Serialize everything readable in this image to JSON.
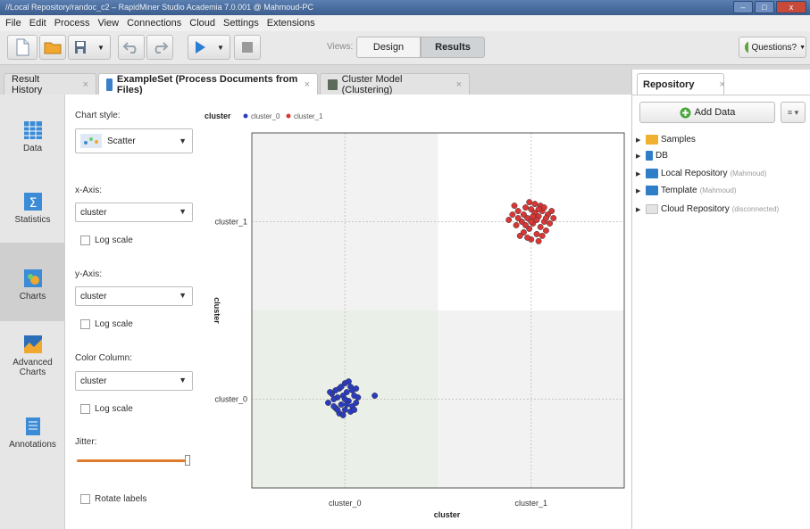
{
  "window": {
    "title": "//Local Repository/randoc_c2 – RapidMiner Studio Academia 7.0.001 @ Mahmoud-PC",
    "buttons": [
      "–",
      "□",
      "x"
    ]
  },
  "menu": [
    "File",
    "Edit",
    "Process",
    "View",
    "Connections",
    "Cloud",
    "Settings",
    "Extensions"
  ],
  "toolbar": {
    "views_label": "Views:",
    "design_label": "Design",
    "results_label": "Results",
    "questions_label": "Questions?"
  },
  "tabs": [
    {
      "label": "Result History",
      "close": "×"
    },
    {
      "label": "ExampleSet (Process Documents from Files)",
      "close": "×"
    },
    {
      "label": "Cluster Model (Clustering)",
      "close": "×"
    }
  ],
  "nav": [
    {
      "label": "Data"
    },
    {
      "label": "Statistics"
    },
    {
      "label": "Charts"
    },
    {
      "label_line1": "Advanced",
      "label_line2": "Charts"
    },
    {
      "label": "Annotations"
    }
  ],
  "config": {
    "chart_style_label": "Chart style:",
    "chart_style_value": "Scatter",
    "x_axis_label": "x-Axis:",
    "x_axis_value": "cluster",
    "y_axis_label": "y-Axis:",
    "y_axis_value": "cluster",
    "color_label": "Color Column:",
    "color_value": "cluster",
    "log_scale_label": "Log scale",
    "jitter_label": "Jitter:",
    "jitter_level": 1.0,
    "rotate_label": "Rotate labels"
  },
  "repository": {
    "tab_label": "Repository",
    "close": "×",
    "add_data_label": "Add Data",
    "menu_glyph": "≡ ▾",
    "items": [
      {
        "label": "Samples",
        "meta": ""
      },
      {
        "label": "DB",
        "meta": ""
      },
      {
        "label": "Local Repository",
        "meta": "(Mahmoud)"
      },
      {
        "label": "Template",
        "meta": "(Mahmoud)"
      },
      {
        "label": "Cloud Repository",
        "meta": "(disconnected)"
      }
    ]
  },
  "colors": {
    "cluster_0": "#2b3bbf",
    "cluster_1": "#d93636",
    "accent": "#e07b2c"
  },
  "chart_data": {
    "type": "scatter",
    "title": "cluster",
    "xlabel": "cluster",
    "ylabel": "cluster",
    "categories": [
      "cluster_0",
      "cluster_1"
    ],
    "legend_position": "top-left",
    "grid": true,
    "series": [
      {
        "name": "cluster_0",
        "color": "#2b3bbf",
        "points": [
          [
            -0.09,
            -0.02
          ],
          [
            -0.07,
            0.03
          ],
          [
            -0.05,
            -0.05
          ],
          [
            -0.04,
            0.01
          ],
          [
            -0.03,
            0.06
          ],
          [
            -0.02,
            -0.03
          ],
          [
            -0.01,
            0.02
          ],
          [
            0.0,
            -0.06
          ],
          [
            0.01,
            0.04
          ],
          [
            0.02,
            -0.01
          ],
          [
            0.03,
            0.07
          ],
          [
            0.04,
            -0.04
          ],
          [
            0.05,
            0.02
          ],
          [
            0.06,
            -0.02
          ],
          [
            -0.06,
            0.0
          ],
          [
            -0.08,
            0.04
          ],
          [
            0.0,
            0.09
          ],
          [
            0.02,
            0.1
          ],
          [
            -0.03,
            -0.08
          ],
          [
            0.04,
            0.05
          ],
          [
            0.07,
            0.01
          ],
          [
            -0.01,
            -0.09
          ],
          [
            0.01,
            -0.03
          ],
          [
            -0.04,
            -0.06
          ],
          [
            0.03,
            -0.07
          ],
          [
            -0.02,
            0.07
          ],
          [
            0.05,
            -0.06
          ],
          [
            -0.06,
            -0.04
          ],
          [
            0.16,
            0.02
          ],
          [
            0.06,
            0.06
          ],
          [
            -0.05,
            0.05
          ],
          [
            0.0,
            0.0
          ]
        ]
      },
      {
        "name": "cluster_1",
        "color": "#d93636",
        "points": [
          [
            -0.1,
            0.04
          ],
          [
            -0.08,
            -0.02
          ],
          [
            -0.07,
            0.06
          ],
          [
            -0.05,
            0.0
          ],
          [
            -0.04,
            -0.06
          ],
          [
            -0.03,
            0.08
          ],
          [
            -0.02,
            0.02
          ],
          [
            -0.01,
            -0.04
          ],
          [
            0.0,
            0.07
          ],
          [
            0.01,
            -0.01
          ],
          [
            0.02,
            0.05
          ],
          [
            0.03,
            -0.07
          ],
          [
            0.04,
            0.03
          ],
          [
            0.05,
            -0.03
          ],
          [
            0.06,
            0.06
          ],
          [
            0.07,
            0.0
          ],
          [
            0.08,
            -0.05
          ],
          [
            0.09,
            0.04
          ],
          [
            -0.06,
            -0.08
          ],
          [
            0.0,
            -0.1
          ],
          [
            0.02,
            0.1
          ],
          [
            0.05,
            0.09
          ],
          [
            -0.03,
            -0.02
          ],
          [
            0.03,
            0.01
          ],
          [
            0.06,
            -0.08
          ],
          [
            -0.09,
            0.09
          ],
          [
            0.1,
            -0.01
          ],
          [
            -0.01,
            0.11
          ],
          [
            0.04,
            -0.11
          ],
          [
            0.12,
            0.02
          ],
          [
            -0.12,
            0.01
          ],
          [
            0.07,
            0.08
          ],
          [
            -0.04,
            0.04
          ],
          [
            0.01,
            0.03
          ],
          [
            0.08,
            0.02
          ],
          [
            -0.02,
            -0.09
          ],
          [
            0.11,
            0.06
          ],
          [
            0.0,
            0.0
          ],
          [
            -0.07,
            0.02
          ],
          [
            0.04,
            0.07
          ]
        ]
      }
    ]
  }
}
